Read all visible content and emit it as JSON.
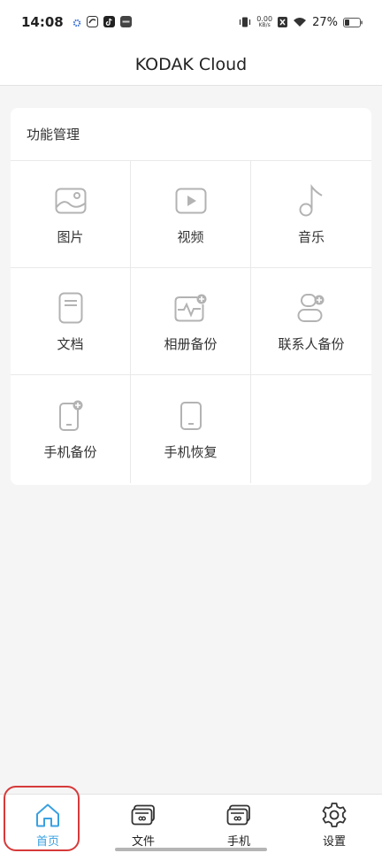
{
  "status_bar": {
    "time": "14:08",
    "net_speed_value": "0.00",
    "net_speed_unit": "KB/s",
    "battery": "27%"
  },
  "header": {
    "title": "KODAK Cloud"
  },
  "features": {
    "title": "功能管理",
    "items": [
      {
        "label": "图片",
        "icon": "image-icon"
      },
      {
        "label": "视频",
        "icon": "video-icon"
      },
      {
        "label": "音乐",
        "icon": "music-icon"
      },
      {
        "label": "文档",
        "icon": "document-icon"
      },
      {
        "label": "相册备份",
        "icon": "album-backup-icon"
      },
      {
        "label": "联系人备份",
        "icon": "contacts-backup-icon"
      },
      {
        "label": "手机备份",
        "icon": "phone-backup-icon"
      },
      {
        "label": "手机恢复",
        "icon": "phone-restore-icon"
      }
    ]
  },
  "bottom_nav": {
    "items": [
      {
        "label": "首页",
        "icon": "home-icon",
        "active": true
      },
      {
        "label": "文件",
        "icon": "files-icon",
        "active": false
      },
      {
        "label": "手机",
        "icon": "phone-icon",
        "active": false
      },
      {
        "label": "设置",
        "icon": "settings-icon",
        "active": false
      }
    ]
  },
  "colors": {
    "accent": "#3aa0e0",
    "icon_gray": "#b3b3b3",
    "highlight": "#d63a3a",
    "background": "#f5f5f5"
  }
}
